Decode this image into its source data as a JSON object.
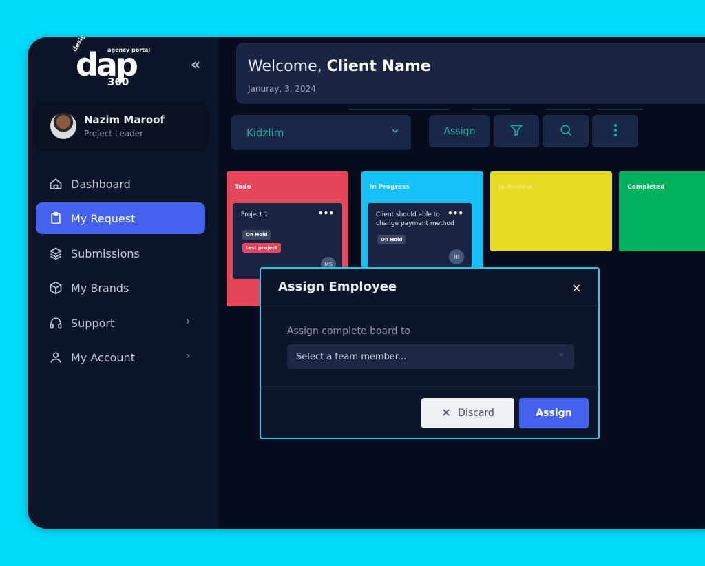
{
  "brand": {
    "logo_text": "dap",
    "logo_small": "design",
    "logo_tag": "agency portal",
    "logo_number": "360"
  },
  "profile": {
    "name": "Nazim Maroof",
    "role": "Project Leader"
  },
  "nav": {
    "items": [
      {
        "label": "Dashboard",
        "icon": "home-icon",
        "active": false,
        "has_submenu": false
      },
      {
        "label": "My Request",
        "icon": "clipboard-icon",
        "active": true,
        "has_submenu": false
      },
      {
        "label": "Submissions",
        "icon": "layers-icon",
        "active": false,
        "has_submenu": false
      },
      {
        "label": "My Brands",
        "icon": "box-icon",
        "active": false,
        "has_submenu": false
      },
      {
        "label": "Support",
        "icon": "headphones-icon",
        "active": false,
        "has_submenu": true
      },
      {
        "label": "My Account",
        "icon": "user-icon",
        "active": false,
        "has_submenu": true
      }
    ],
    "chevron": "›",
    "collapse": "«"
  },
  "header": {
    "welcome_prefix": "Welcome,",
    "welcome_name": "Client Name",
    "date": "Januray, 3, 2024"
  },
  "toolbar": {
    "board": "Kidzlim",
    "assign_label": "Assign"
  },
  "columns": [
    {
      "title": "Todo",
      "color": "#e6465a"
    },
    {
      "title": "In Progress",
      "color": "#16c1f7"
    },
    {
      "title": "In Review",
      "color": "#e6da22"
    },
    {
      "title": "Completed",
      "color": "#00b15b"
    }
  ],
  "tasks": [
    {
      "title": "Project 1",
      "badges": [
        "On Hold",
        "test project"
      ],
      "assignee": "MS",
      "dots": "•••"
    },
    {
      "title_line1": "Client should able to",
      "title_line2": "change payment method",
      "badges": [
        "On Hold"
      ],
      "assignee": "HI",
      "dots": "•••"
    }
  ],
  "modal": {
    "title": "Assign Employee",
    "close": "×",
    "label": "Assign complete board to",
    "select_placeholder": "Select a team member...",
    "discard_label": "Discard",
    "assign_label": "Assign"
  },
  "colors": {
    "accent": "#4462ee",
    "teal": "#19b3a6",
    "modal_border": "#29c6ee",
    "background": "#00dcfc"
  }
}
